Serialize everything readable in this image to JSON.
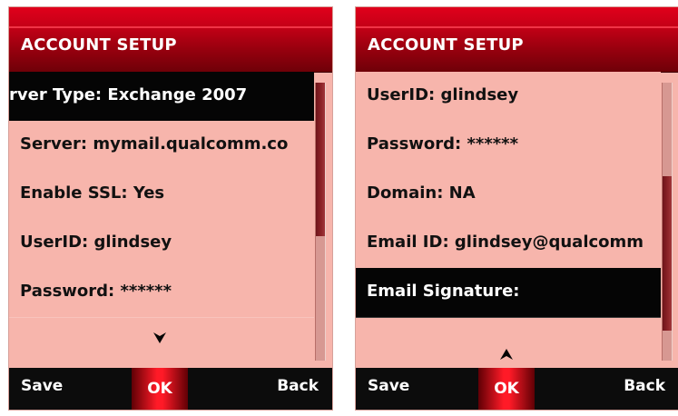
{
  "screens": [
    {
      "title": "ACCOUNT SETUP",
      "rows": [
        "rver Type: Exchange 2007",
        "Server: mymail.qualcomm.co",
        "Enable SSL: Yes",
        "UserID: glindsey",
        "Password: ******"
      ],
      "selected_row": "rver Type: Exchange 2007",
      "scroll_indicator_icon": "arrow-down-icon",
      "softkeys": {
        "left": "Save",
        "center": "OK",
        "right": "Back"
      }
    },
    {
      "title": "ACCOUNT SETUP",
      "rows": [
        "UserID: glindsey",
        "Password: ******",
        "Domain: NA",
        "Email ID: glindsey@qualcomm",
        "Email Signature:"
      ],
      "selected_row": "Email Signature:",
      "scroll_indicator_icon": "arrow-up-icon",
      "softkeys": {
        "left": "Save",
        "center": "OK",
        "right": "Back"
      }
    }
  ],
  "colors": {
    "header_red": "#d10019",
    "list_background": "#f7b5ac",
    "selected_row": "#050505",
    "scroll_thumb": "#8e2428",
    "softkey_bar": "#0c0c0c",
    "ok_key_red": "#ff1a27"
  }
}
